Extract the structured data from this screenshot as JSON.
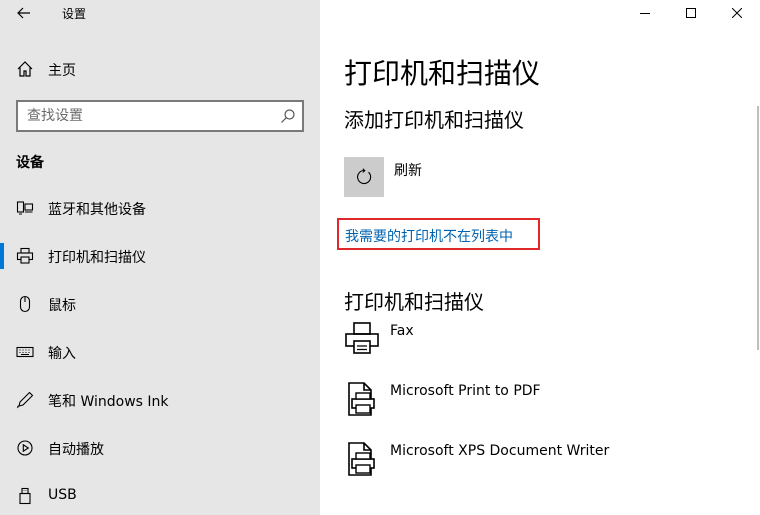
{
  "window": {
    "app_title": "设置"
  },
  "sidebar": {
    "home_label": "主页",
    "search_placeholder": "查找设置",
    "section_heading": "设备",
    "items": [
      {
        "label": "蓝牙和其他设备",
        "icon": "bluetooth-devices-icon",
        "selected": false
      },
      {
        "label": "打印机和扫描仪",
        "icon": "printer-icon",
        "selected": true
      },
      {
        "label": "鼠标",
        "icon": "mouse-icon",
        "selected": false
      },
      {
        "label": "输入",
        "icon": "keyboard-icon",
        "selected": false
      },
      {
        "label": "笔和 Windows Ink",
        "icon": "pen-icon",
        "selected": false
      },
      {
        "label": "自动播放",
        "icon": "autoplay-icon",
        "selected": false
      },
      {
        "label": "USB",
        "icon": "usb-icon",
        "selected": false
      }
    ]
  },
  "main": {
    "page_title": "打印机和扫描仪",
    "add_heading": "添加打印机和扫描仪",
    "refresh_label": "刷新",
    "missing_link": "我需要的打印机不在列表中",
    "list_heading": "打印机和扫描仪",
    "printers": [
      {
        "name": "Fax",
        "icon": "fax-printer-icon"
      },
      {
        "name": "Microsoft Print to PDF",
        "icon": "document-printer-icon"
      },
      {
        "name": "Microsoft XPS Document Writer",
        "icon": "document-printer-icon"
      }
    ]
  },
  "colors": {
    "sidebar_bg": "#e6e6e6",
    "accent": "#0078d7",
    "link": "#0063b1",
    "highlight_border": "#e0282a"
  }
}
